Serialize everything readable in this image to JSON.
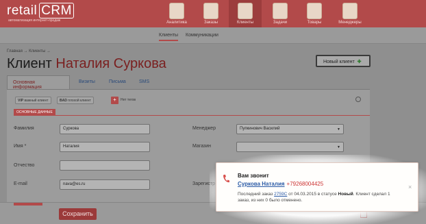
{
  "brand": {
    "logo_main": "retail",
    "logo_crm": "CRM",
    "tagline": "автоматизация интернет-продаж"
  },
  "nav": [
    {
      "label": "Аналитика",
      "icon": "analytics-icon"
    },
    {
      "label": "Заказы",
      "icon": "orders-icon"
    },
    {
      "label": "Клиенты",
      "icon": "clients-icon",
      "active": true
    },
    {
      "label": "Задачи",
      "icon": "tasks-icon"
    },
    {
      "label": "Товары",
      "icon": "products-icon"
    },
    {
      "label": "Менеджеры",
      "icon": "managers-icon"
    }
  ],
  "subnav": {
    "clients": "Клиенты",
    "communications": "Коммуникации"
  },
  "breadcrumbs": "Главная → Клиенты →",
  "page": {
    "title_prefix": "Клиент",
    "title_name": "Наталия Суркова",
    "new_client_label": "Новый клиент"
  },
  "tabs": [
    "Основная информация",
    "Визиты",
    "Письма",
    "SMS"
  ],
  "badges": {
    "vip_key": "VIP",
    "vip_val": "важный клиент",
    "bad_key": "BAD",
    "bad_val": "плохой клиент",
    "no_tags": "Нет тегов"
  },
  "section": {
    "basic": "ОСНОВНЫЕ ДАННЫЕ"
  },
  "form": {
    "surname_label": "Фамилия",
    "surname_value": "Суркова",
    "name_label": "Имя *",
    "name_value": "Наталия",
    "patronymic_label": "Отчество",
    "patronymic_value": "",
    "email_label": "E-mail",
    "email_value": "nava@es.ru",
    "manager_label": "Менеджер",
    "manager_value": "Пупкинович Василий",
    "shop_label": "Магазин",
    "shop_value": "",
    "registered_label": "Зарегистр"
  },
  "actions": {
    "save": "Сохранить"
  },
  "popup": {
    "title": "Вам звонит",
    "client_name": "Суркова Наталия",
    "phone": "+79268004425",
    "desc_1": "Последний заказ",
    "order": "2759С",
    "desc_2": "от 04.03.2015 в статусе",
    "status": "Новый",
    "desc_3": ". Клиент сделал 1 заказ, из них 0 было отменено.",
    "close": "×"
  },
  "colors": {
    "brand": "#b24a4a",
    "link": "#2a5aa6",
    "phone": "#cc3333"
  }
}
